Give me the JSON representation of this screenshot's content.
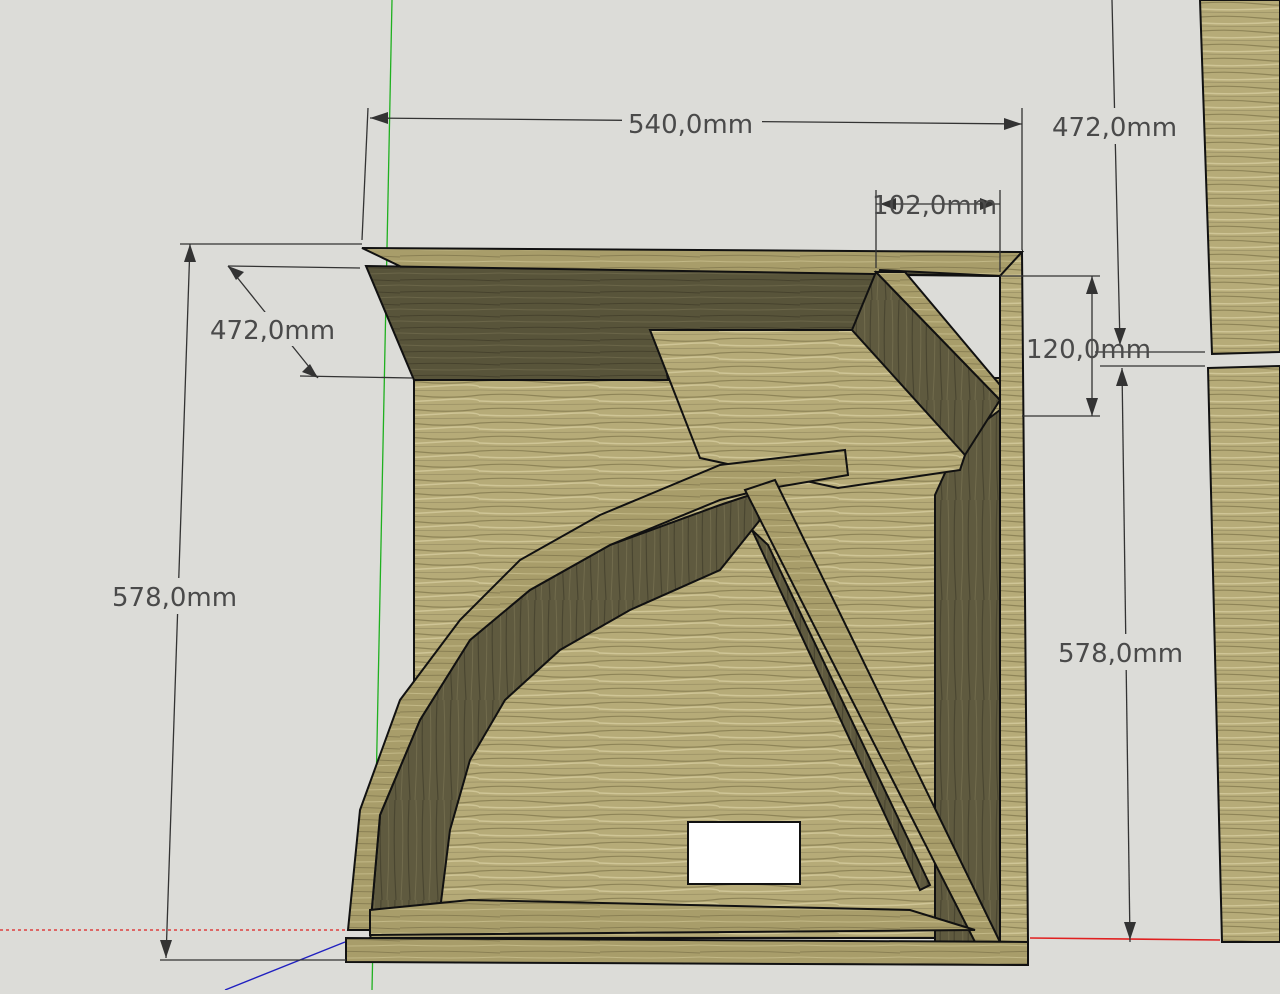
{
  "viewport": {
    "background": "#dcdcd8",
    "axes": {
      "green": "#1fb01f",
      "red": "#e02020",
      "blue": "#2020c0"
    }
  },
  "dimensions": {
    "top_width": "540,0mm",
    "top_right_height": "472,0mm",
    "top_small_width": "102,0mm",
    "left_diagonal": "472,0mm",
    "left_height": "578,0mm",
    "right_small_height": "120,0mm",
    "right_height": "578,0mm"
  },
  "materials": {
    "wood_light": "#b6ab78",
    "wood_mid": "#9e9362",
    "wood_dark": "#5f5a3f"
  }
}
